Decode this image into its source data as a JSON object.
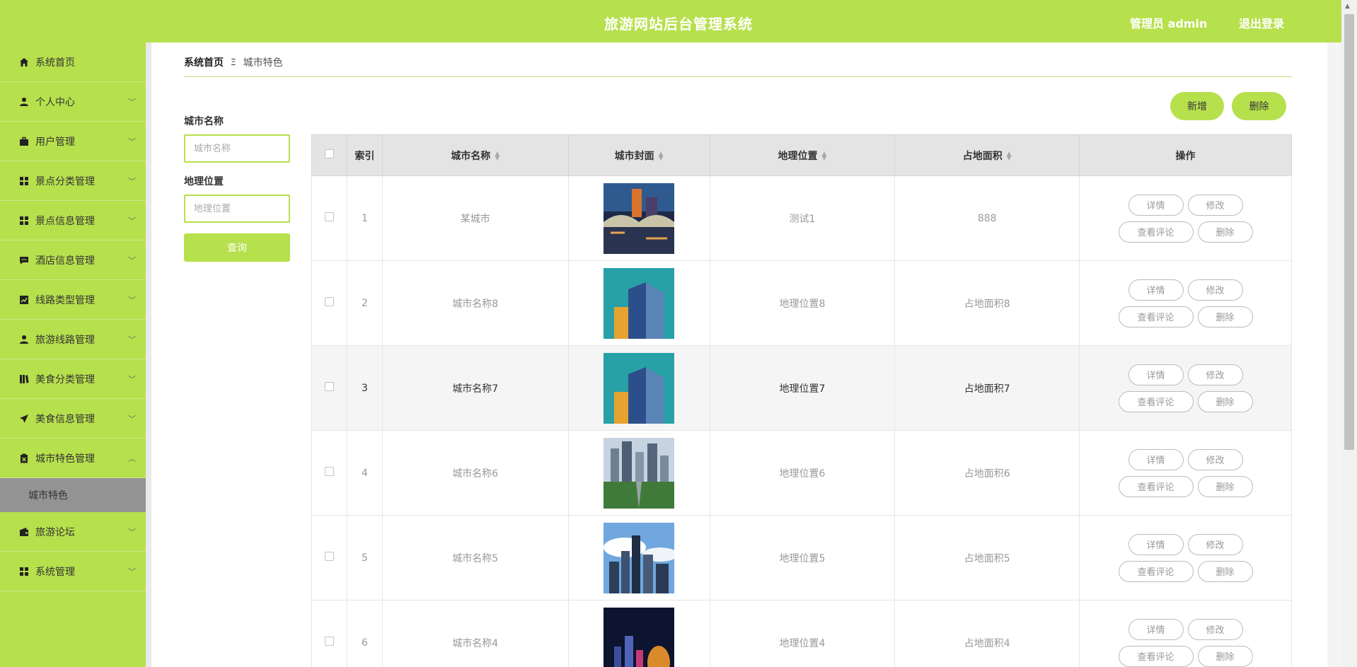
{
  "header": {
    "title": "旅游网站后台管理系统",
    "user": "管理员 admin",
    "logout": "退出登录"
  },
  "sidebar": {
    "items": [
      {
        "label": "系统首页",
        "icon": "home-icon"
      },
      {
        "label": "个人中心",
        "icon": "user-icon"
      },
      {
        "label": "用户管理",
        "icon": "briefcase-icon"
      },
      {
        "label": "景点分类管理",
        "icon": "grid-icon"
      },
      {
        "label": "景点信息管理",
        "icon": "grid-icon"
      },
      {
        "label": "酒店信息管理",
        "icon": "chat-icon"
      },
      {
        "label": "线路类型管理",
        "icon": "chart-icon"
      },
      {
        "label": "旅游线路管理",
        "icon": "user-icon"
      },
      {
        "label": "美食分类管理",
        "icon": "book-icon"
      },
      {
        "label": "美食信息管理",
        "icon": "send-icon"
      },
      {
        "label": "城市特色管理",
        "icon": "clipboard-icon"
      },
      {
        "label": "旅游论坛",
        "icon": "wallet-icon"
      },
      {
        "label": "系统管理",
        "icon": "grid-icon"
      }
    ],
    "submenu": "城市特色"
  },
  "breadcrumb": {
    "home": "系统首页",
    "separator": "Ξ",
    "current": "城市特色"
  },
  "search": {
    "city_label": "城市名称",
    "city_placeholder": "城市名称",
    "location_label": "地理位置",
    "location_placeholder": "地理位置",
    "query": "查询"
  },
  "actions": {
    "add": "新增",
    "delete": "删除"
  },
  "table": {
    "headers": [
      "索引",
      "城市名称",
      "城市封面",
      "地理位置",
      "占地面积",
      "操作"
    ],
    "rows": [
      {
        "index": "1",
        "name": "某城市",
        "location": "测试1",
        "area": "888"
      },
      {
        "index": "2",
        "name": "城市名称8",
        "location": "地理位置8",
        "area": "占地面积8"
      },
      {
        "index": "3",
        "name": "城市名称7",
        "location": "地理位置7",
        "area": "占地面积7"
      },
      {
        "index": "4",
        "name": "城市名称6",
        "location": "地理位置6",
        "area": "占地面积6"
      },
      {
        "index": "5",
        "name": "城市名称5",
        "location": "地理位置5",
        "area": "占地面积5"
      },
      {
        "index": "6",
        "name": "城市名称4",
        "location": "地理位置4",
        "area": "占地面积4"
      }
    ],
    "row_actions": {
      "detail": "详情",
      "edit": "修改",
      "comments": "查看评论",
      "delete": "删除"
    }
  },
  "colors": {
    "accent": "#b7e04d",
    "submenu_bg": "#939393"
  }
}
